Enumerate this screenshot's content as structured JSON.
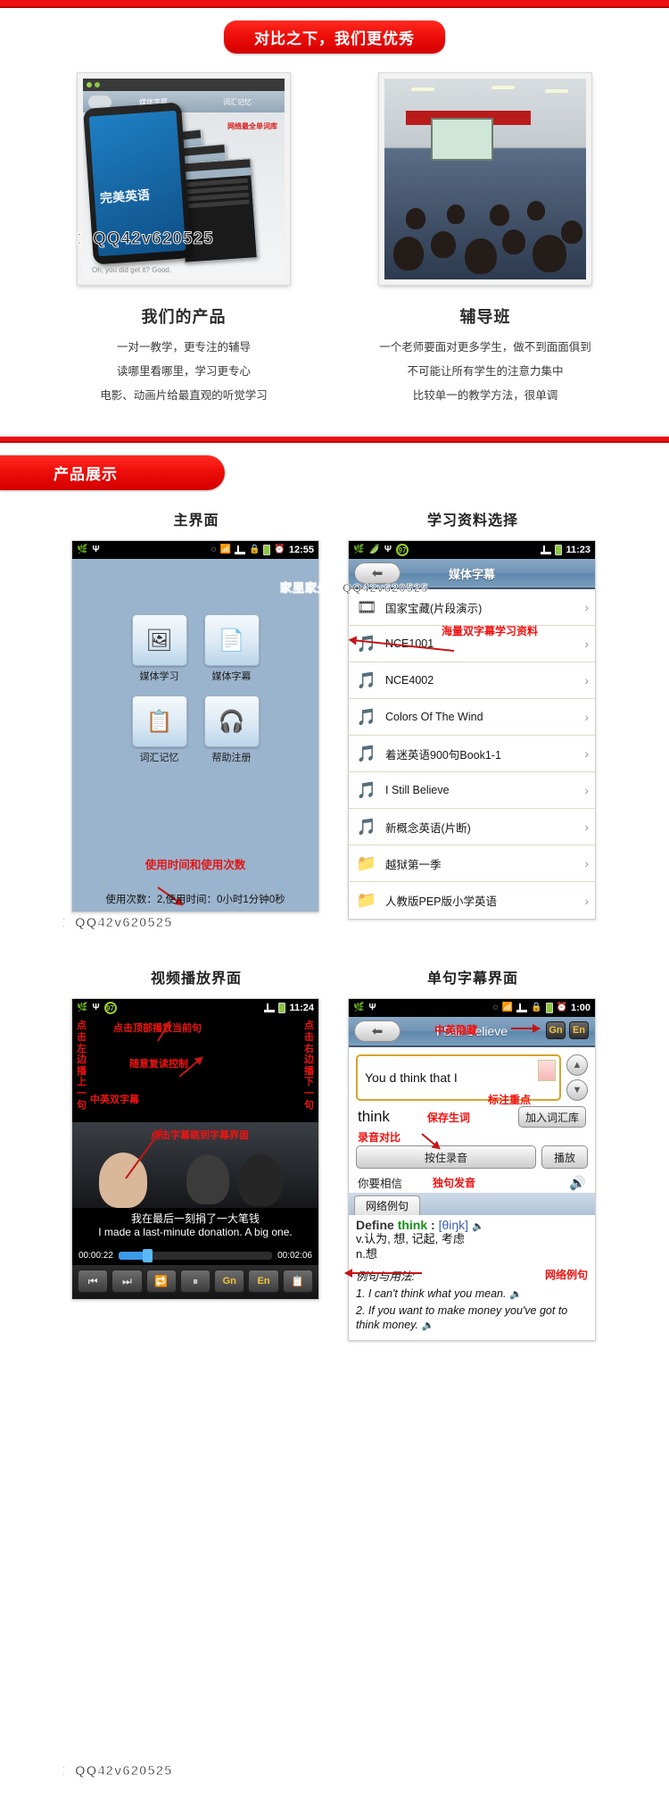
{
  "watermarks": {
    "main": "家里家外：QQ42v620525",
    "section3": "家里家外：QQ42v620525",
    "footer": "家里家外：QQ42v620525"
  },
  "section_compare": {
    "banner": "对比之下，我们更优秀",
    "columns": [
      {
        "title": "我们的产品",
        "image_name": "product-phone-collage",
        "lines": [
          "一对一教学，更专注的辅导",
          "读哪里看哪里，学习更专心",
          "电影、动画片给最直观的听觉学习"
        ]
      },
      {
        "title": "辅导班",
        "image_name": "classroom-photo",
        "lines": [
          "一个老师要面对更多学生，做不到面面俱到",
          "不可能让所有学生的注意力集中",
          "比较单一的教学方法，很单调"
        ]
      }
    ]
  },
  "section_showcase": {
    "banner": "产品展示",
    "home_screen": {
      "title": "主界面",
      "statusbar": {
        "time": "12:55",
        "icons": [
          "leaf-icon",
          "usb-icon",
          "vibrate-icon",
          "wifi-icon",
          "signal-icon",
          "lock-icon",
          "battery-icon",
          "alarm-icon"
        ]
      },
      "apps": [
        {
          "label": "媒体学习",
          "glyph": "🖼",
          "icon_name": "media-study-icon"
        },
        {
          "label": "媒体字幕",
          "glyph": "📄",
          "icon_name": "media-subtitle-icon"
        },
        {
          "label": "词汇记忆",
          "glyph": "📋",
          "icon_name": "vocabulary-icon"
        },
        {
          "label": "帮助注册",
          "glyph": "🎧",
          "icon_name": "help-register-icon"
        }
      ],
      "annotation": "使用时间和使用次数",
      "stat_line": "使用次数：2,使用时间：0小时1分钟0秒"
    },
    "list_screen": {
      "title": "学习资料选择",
      "statusbar": {
        "time": "11:23",
        "badge": "97",
        "icons": [
          "leaf-icon",
          "pea-icon",
          "usb-icon",
          "signal-icon",
          "battery-icon"
        ]
      },
      "titlebar": "媒体字幕",
      "annotation": "海量双字幕学习资料",
      "rows": [
        {
          "label": "国家宝藏(片段演示)",
          "icon_name": "film-icon",
          "glyph": "🎞"
        },
        {
          "label": "NCE1001",
          "icon_name": "audio-icon",
          "glyph": "🎵"
        },
        {
          "label": "NCE4002",
          "icon_name": "audio-icon",
          "glyph": "🎵"
        },
        {
          "label": "Colors Of The Wind",
          "icon_name": "audio-icon",
          "glyph": "🎵"
        },
        {
          "label": "着迷英语900句Book1-1",
          "icon_name": "audio-icon",
          "glyph": "🎵"
        },
        {
          "label": "I Still Believe",
          "icon_name": "audio-icon",
          "glyph": "🎵"
        },
        {
          "label": "新概念英语(片断)",
          "icon_name": "audio-icon",
          "glyph": "🎵"
        },
        {
          "label": "越狱第一季",
          "icon_name": "folder-icon",
          "glyph": "📁"
        },
        {
          "label": "人教版PEP版小学英语",
          "icon_name": "folder-icon",
          "glyph": "📁"
        }
      ]
    },
    "video_screen": {
      "title": "视频播放界面",
      "statusbar": {
        "time": "11:24",
        "badge": "97"
      },
      "annotations": {
        "left_vertical": "点击左边播上一句",
        "right_vertical": "点击右边播下一句",
        "top": "点击顶部播放当前句",
        "middle": "随意复读控制",
        "bilingual": "中英双字幕",
        "jump": "点击字幕跳到字幕界面"
      },
      "subtitle_cn": "我在最后一刻捐了一大笔钱",
      "subtitle_en": "I made a last-minute donation. A big one.",
      "time_current": "00:00:22",
      "time_total": "00:02:06",
      "controls": [
        {
          "name": "prev-button",
          "glyph": "⏮"
        },
        {
          "name": "next-button",
          "glyph": "⏭"
        },
        {
          "name": "repeat-button",
          "glyph": "🔁"
        },
        {
          "name": "pause-button",
          "glyph": "⏸"
        },
        {
          "name": "cn-toggle",
          "glyph": "Gn"
        },
        {
          "name": "en-toggle",
          "glyph": "En"
        },
        {
          "name": "list-button",
          "glyph": "📋"
        }
      ]
    },
    "sentence_screen": {
      "title": "单句字幕界面",
      "statusbar": {
        "time": "1:00"
      },
      "titlebar": "I Still Believe",
      "annotations": {
        "hide": "中英隐藏",
        "mark": "标注重点",
        "save_word": "保存生词",
        "record_compare": "录音对比",
        "sentence_speak": "独句发音",
        "web_examples": "网络例句"
      },
      "tag_buttons": [
        "Gn",
        "En"
      ],
      "input_value": "You d think that I",
      "word": "think",
      "buttons": {
        "add_vocab": "加入词汇库",
        "record": "按住录音",
        "play": "播放"
      },
      "cn_line": "你要相信",
      "tab_label": "网络例句",
      "dictionary": {
        "define_prefix": "Define",
        "word": "think",
        "phonetic": "[θiŋk]",
        "def_v": "v.认为, 想, 记起, 考虑",
        "def_n": "n.想",
        "examples_heading": "例句与用法:",
        "examples": [
          "1. I can't think what you mean.",
          "2. If you want to make money you've got to think money."
        ]
      }
    }
  }
}
